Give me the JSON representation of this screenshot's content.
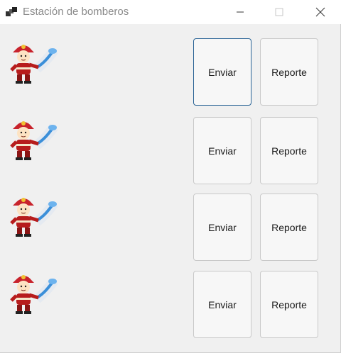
{
  "window": {
    "title": "Estación de bomberos",
    "app_icon": "app-window-icon",
    "controls": {
      "minimize_icon": "minimize-icon",
      "maximize_icon": "maximize-icon",
      "close_icon": "close-icon"
    }
  },
  "stations": [
    {
      "image": "firefighter-icon",
      "send_label": "Enviar",
      "report_label": "Reporte"
    },
    {
      "image": "firefighter-icon",
      "send_label": "Enviar",
      "report_label": "Reporte"
    },
    {
      "image": "firefighter-icon",
      "send_label": "Enviar",
      "report_label": "Reporte"
    },
    {
      "image": "firefighter-icon",
      "send_label": "Enviar",
      "report_label": "Reporte"
    }
  ],
  "colors": {
    "focus_border": "#2a6496",
    "helmet": "#c8232c",
    "water": "#3b8fd9"
  }
}
